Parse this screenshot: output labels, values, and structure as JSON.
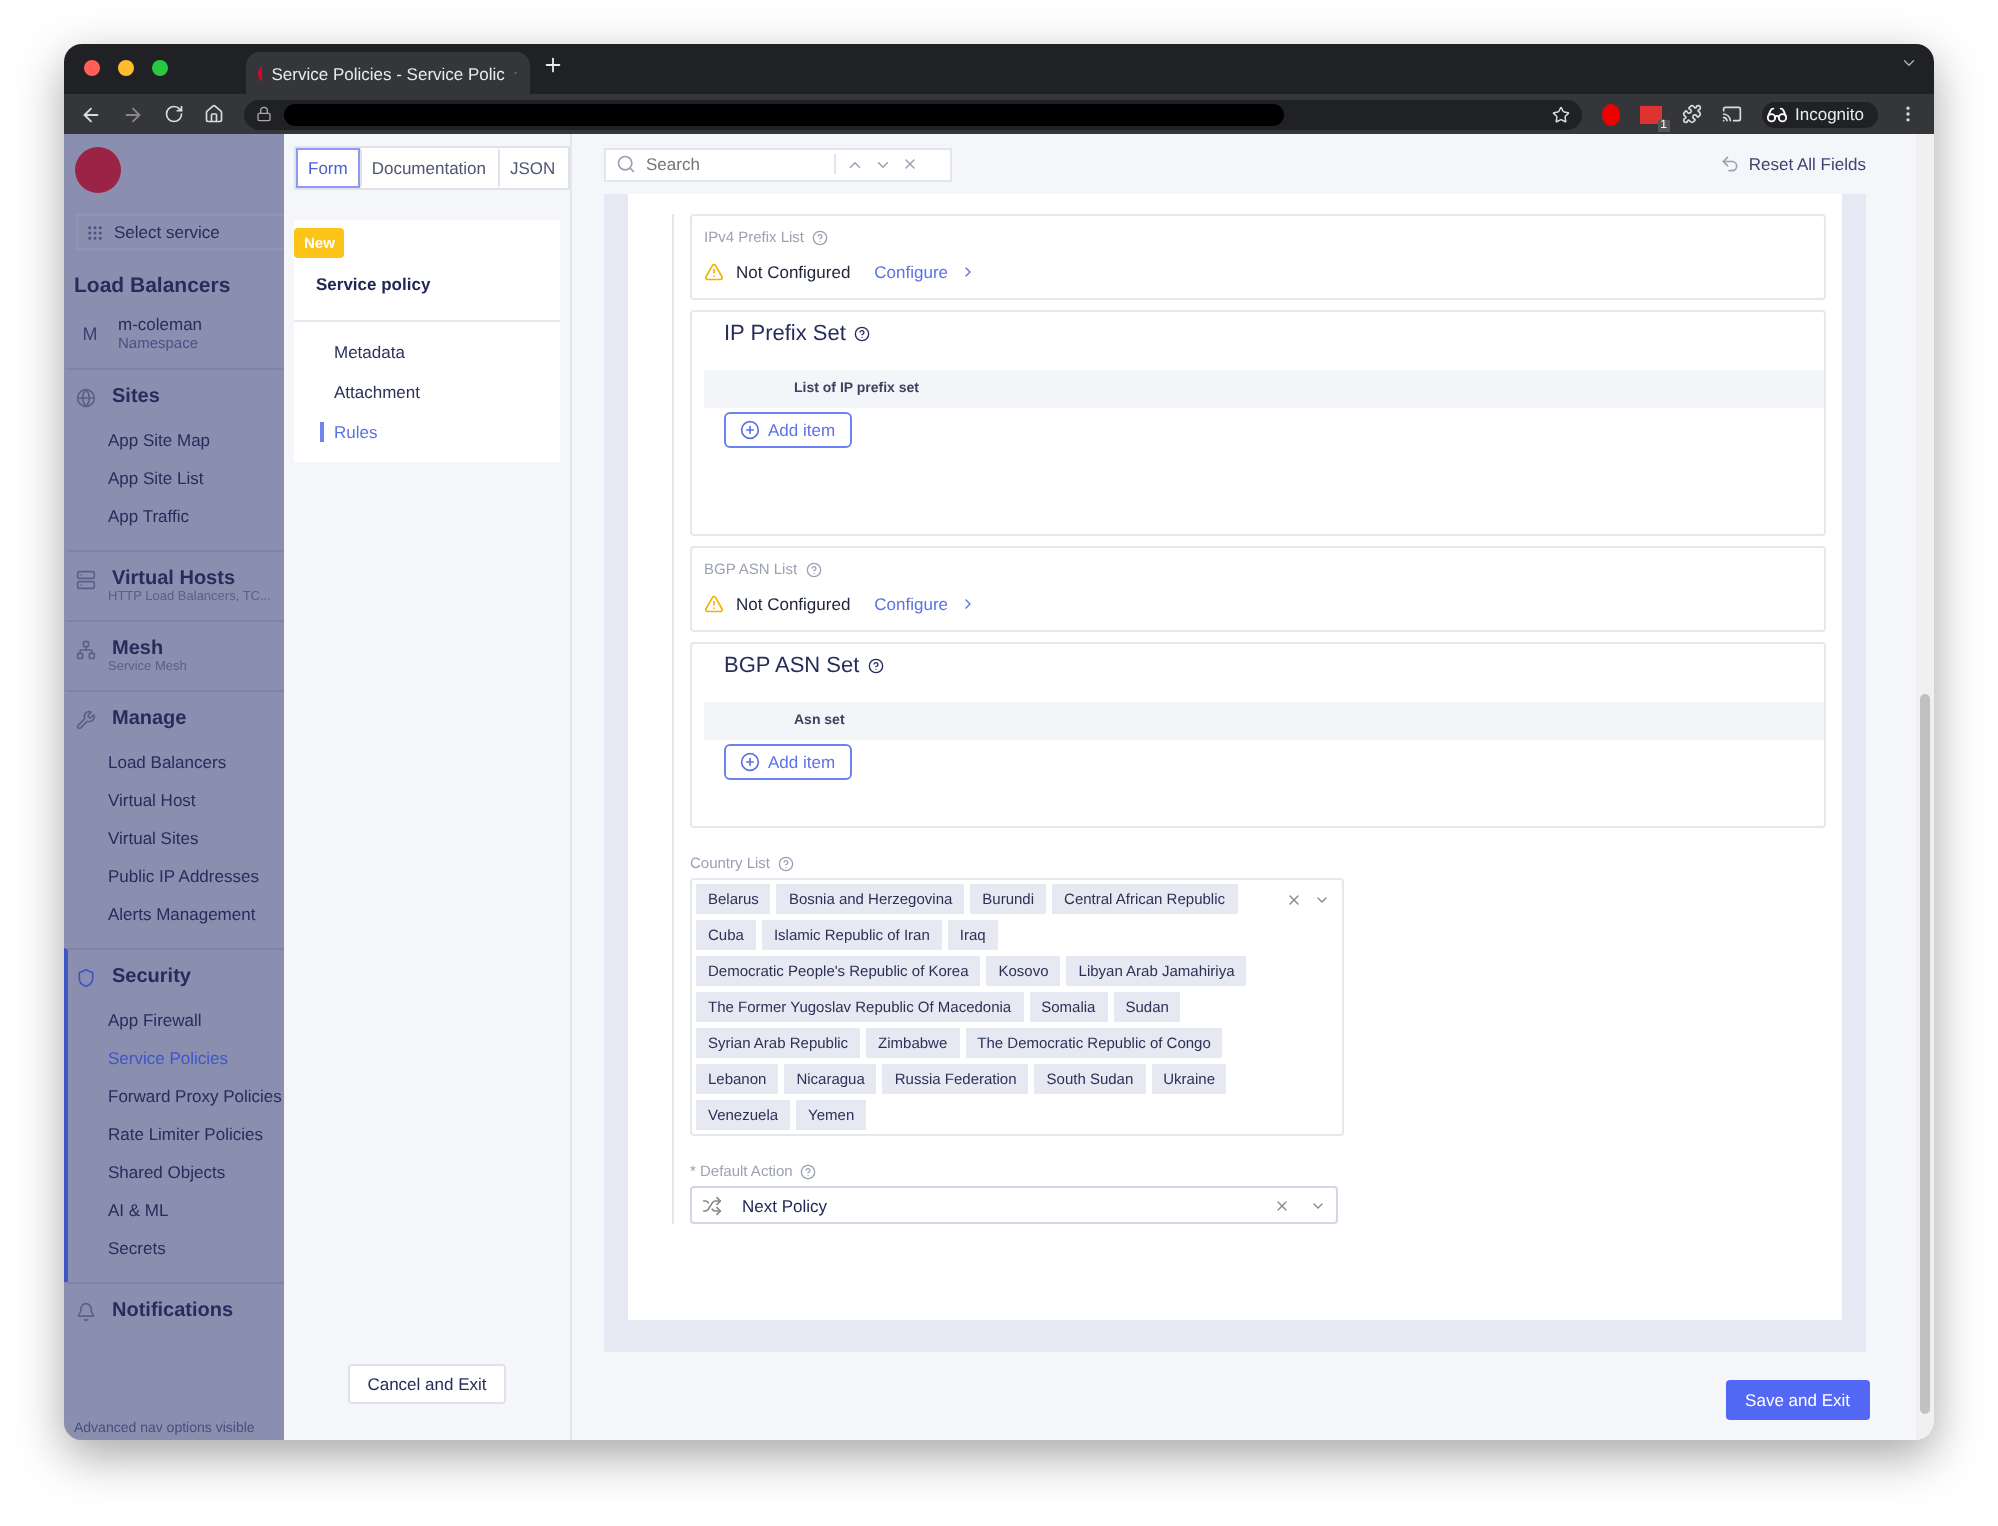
{
  "browser": {
    "tab_title": "Service Policies - Service Polic",
    "profile": "Incognito",
    "extension_badge": "1"
  },
  "nav": {
    "select_service": "Select service",
    "title": "Load Balancers",
    "namespace": {
      "avatar": "M",
      "name": "m-coleman",
      "label": "Namespace"
    },
    "groups": [
      {
        "title": "Sites",
        "active": false,
        "items": [
          {
            "label": "App Site Map",
            "selected": false
          },
          {
            "label": "App Site List",
            "selected": false
          },
          {
            "label": "App Traffic",
            "selected": false
          }
        ]
      },
      {
        "title": "Virtual Hosts",
        "subtitle": "HTTP Load Balancers, TC...",
        "active": false
      },
      {
        "title": "Mesh",
        "subtitle": "Service Mesh",
        "active": false
      },
      {
        "title": "Manage",
        "active": false,
        "items": [
          {
            "label": "Load Balancers",
            "selected": false
          },
          {
            "label": "Virtual Host",
            "selected": false
          },
          {
            "label": "Virtual Sites",
            "selected": false
          },
          {
            "label": "Public IP Addresses",
            "selected": false
          },
          {
            "label": "Alerts Management",
            "selected": false
          }
        ]
      },
      {
        "title": "Security",
        "active": true,
        "items": [
          {
            "label": "App Firewall",
            "selected": false
          },
          {
            "label": "Service Policies",
            "selected": true
          },
          {
            "label": "Forward Proxy Policies",
            "selected": false
          },
          {
            "label": "Rate Limiter Policies",
            "selected": false
          },
          {
            "label": "Shared Objects",
            "selected": false
          },
          {
            "label": "AI & ML",
            "selected": false
          },
          {
            "label": "Secrets",
            "selected": false
          }
        ]
      },
      {
        "title": "Notifications",
        "active": false
      }
    ],
    "footer": "Advanced nav options visible"
  },
  "view_tabs": [
    {
      "label": "Form",
      "selected": true
    },
    {
      "label": "Documentation",
      "selected": false
    },
    {
      "label": "JSON",
      "selected": false
    }
  ],
  "outline": {
    "badge": "New",
    "title": "Service policy",
    "items": [
      {
        "label": "Metadata",
        "selected": false
      },
      {
        "label": "Attachment",
        "selected": false
      },
      {
        "label": "Rules",
        "selected": true
      }
    ]
  },
  "cancel_button": "Cancel and Exit",
  "search": {
    "placeholder": "Search"
  },
  "reset_button": "Reset All Fields",
  "sections": [
    {
      "kind": "config",
      "label": "IPv4 Prefix List",
      "status": "Not Configured",
      "link": "Configure"
    },
    {
      "kind": "set",
      "title": "IP Prefix Set",
      "column": "List of IP prefix set",
      "button": "Add item"
    },
    {
      "kind": "config",
      "label": "BGP ASN List",
      "status": "Not Configured",
      "link": "Configure"
    },
    {
      "kind": "set",
      "title": "BGP ASN Set",
      "column": "Asn set",
      "button": "Add item"
    }
  ],
  "country_list": {
    "label": "Country List",
    "tags": [
      "Belarus",
      "Bosnia and Herzegovina",
      "Burundi",
      "Central African Republic",
      "Cuba",
      "Islamic Republic of Iran",
      "Iraq",
      "Democratic People's Republic of Korea",
      "Kosovo",
      "Libyan Arab Jamahiriya",
      "The Former Yugoslav Republic Of Macedonia",
      "Somalia",
      "Sudan",
      "Syrian Arab Republic",
      "Zimbabwe",
      "The Democratic Republic of Congo",
      "Lebanon",
      "Nicaragua",
      "Russia Federation",
      "South Sudan",
      "Ukraine",
      "Venezuela",
      "Yemen"
    ]
  },
  "default_action": {
    "label": "* Default Action",
    "value": "Next Policy"
  },
  "save_button": "Save and Exit"
}
